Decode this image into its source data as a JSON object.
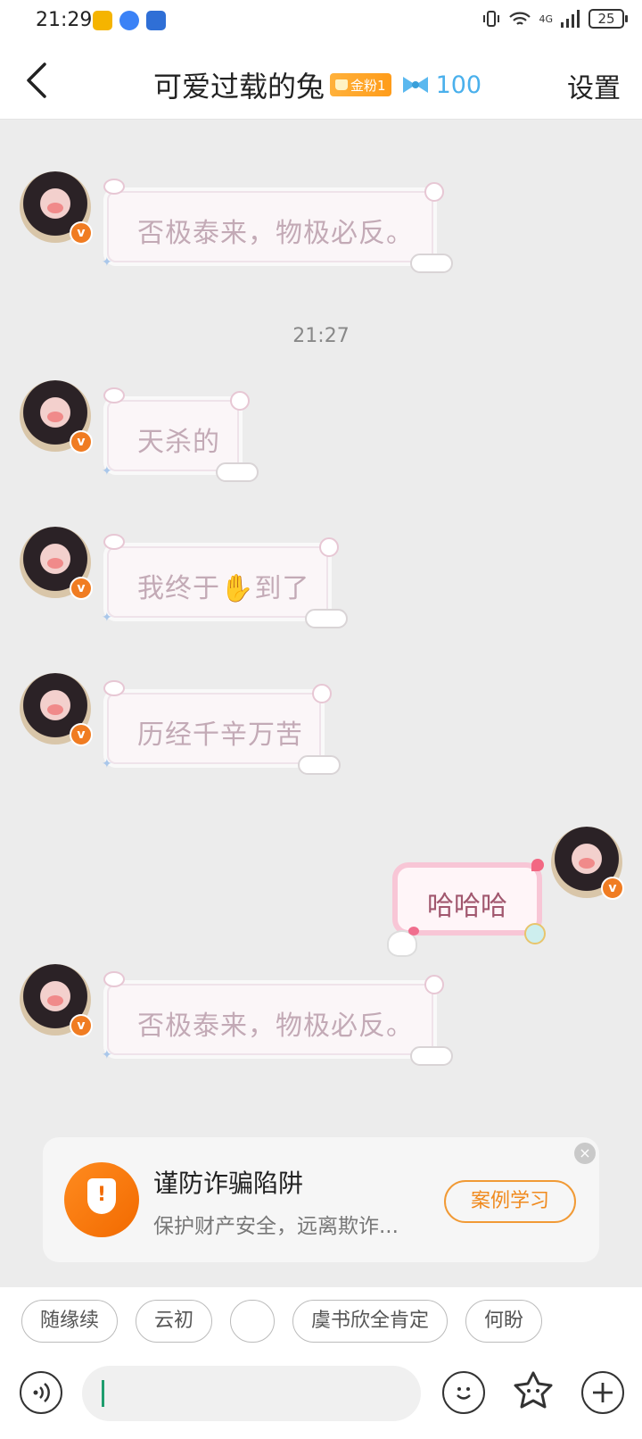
{
  "status_bar": {
    "time": "21:29",
    "battery": "25",
    "network": "4G"
  },
  "header": {
    "back_icon": "chevron-left-icon",
    "title": "可爱过载的兔",
    "fan_badge": "金粉1",
    "fan_icon": "bow-icon",
    "fan_count": "100",
    "settings_label": "设置"
  },
  "messages": [
    {
      "side": "left",
      "text": "否极泰来，物极必反。"
    },
    {
      "side": "left",
      "text": "天杀的"
    },
    {
      "side": "left",
      "text": "我终于✋到了"
    },
    {
      "side": "left",
      "text": "历经千辛万苦"
    },
    {
      "side": "right",
      "text": "哈哈哈"
    },
    {
      "side": "left",
      "text": "否极泰来，物极必反。"
    }
  ],
  "timestamp": "21:27",
  "fraud_card": {
    "title": "谨防诈骗陷阱",
    "description": "保护财产安全，远离欺诈...",
    "button_label": "案例学习",
    "close_symbol": "×"
  },
  "quick_replies": [
    "随缘续",
    "云初",
    "",
    "虞书欣全肯定",
    "何盼"
  ],
  "input": {
    "value": "",
    "voice_icon": "voice-icon",
    "emoji_icon": "emoji-icon",
    "sticker_icon": "sticker-icon",
    "plus_icon": "plus-icon"
  },
  "colors": {
    "accent_orange": "#f07c22",
    "fan_blue": "#4ab0ec",
    "bubble_text": "#c3aab6",
    "background": "#ececec"
  }
}
